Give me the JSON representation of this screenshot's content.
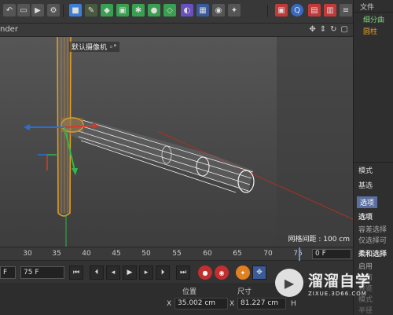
{
  "viewport_menu": "nder",
  "camera_label": "默认摄像机 ◦°",
  "grid_distance": "网格间距 : 100 cm",
  "right_panel": {
    "file_menu": "文件",
    "object_1": "细分曲",
    "object_2": "圆柱",
    "mode_label": "模式",
    "sub_label": "基选",
    "tab_selection": "选项",
    "section_options": "选项",
    "opt_1": "容差选择",
    "opt_2": "仅选择可",
    "section_soft": "柔和选择",
    "opt_enable": "启用",
    "opt_3": "表面",
    "opt_4": "预览",
    "opt_5": "模式",
    "opt_6": "半径"
  },
  "ruler": {
    "labels": [
      "30",
      "35",
      "40",
      "45",
      "50",
      "55",
      "60",
      "65",
      "70",
      "75"
    ],
    "frame_value": "0 F"
  },
  "transport": {
    "start_frame": "F",
    "end_frame": "75 F"
  },
  "coords": {
    "position_header": "位置",
    "size_header": "尺寸",
    "x_label": "X",
    "position_x": "35.002 cm",
    "size_x": "81.227 cm",
    "rot_label": "H"
  },
  "watermark": {
    "title": "溜溜自学",
    "url": "ZIXUE.3D66.COM"
  },
  "colors": {
    "accent": "#5b6fa0",
    "selection_orange": "#e8a020",
    "axis_red": "#d43a2a",
    "axis_green": "#2fb84a",
    "axis_blue": "#2a6fd4"
  }
}
